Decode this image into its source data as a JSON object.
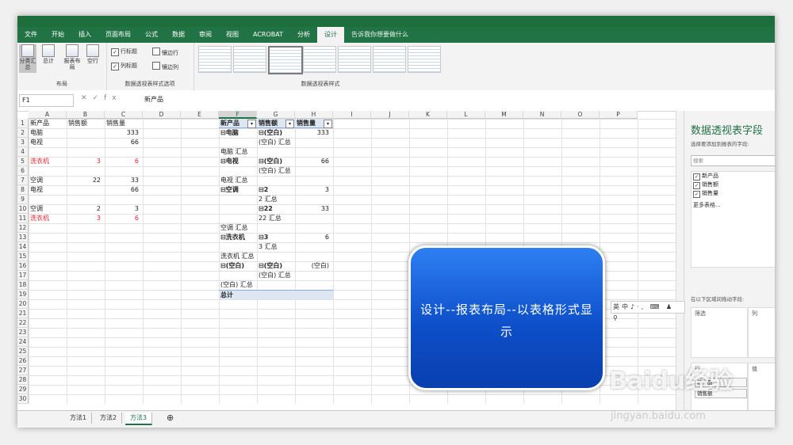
{
  "ribbon_tabs": [
    "文件",
    "开始",
    "插入",
    "页面布局",
    "公式",
    "数据",
    "审阅",
    "视图",
    "ACROBAT",
    "分析",
    "设计"
  ],
  "tell_me": "告诉我你想要做什么",
  "ribbon": {
    "layout_buttons": [
      "分类汇总",
      "总计",
      "报表布局",
      "空行"
    ],
    "group_layout": "布局",
    "options": [
      {
        "label": "行标题",
        "checked": true
      },
      {
        "label": "镶边行",
        "checked": false
      },
      {
        "label": "列标题",
        "checked": true
      },
      {
        "label": "镶边列",
        "checked": false
      }
    ],
    "group_options": "数据透视表样式选项",
    "group_styles": "数据透视表样式"
  },
  "formula": {
    "name_box": "F1",
    "fx": "fx",
    "value": "新产品"
  },
  "columns": [
    "A",
    "B",
    "C",
    "D",
    "E",
    "F",
    "G",
    "H",
    "I",
    "J",
    "K",
    "L",
    "M",
    "N",
    "O",
    "P"
  ],
  "rows": [
    "1",
    "2",
    "3",
    "4",
    "5",
    "6",
    "7",
    "8",
    "9",
    "10",
    "11",
    "12",
    "13",
    "14",
    "15",
    "16",
    "17",
    "18",
    "19",
    "20",
    "21",
    "22",
    "23",
    "24",
    "25",
    "26",
    "27",
    "28",
    "29",
    "30",
    "31"
  ],
  "table": {
    "headers": [
      "新产品",
      "销售额",
      "销售量"
    ],
    "rows": [
      {
        "a": "电脑",
        "b": "",
        "c": "333",
        "red": false
      },
      {
        "a": "电视",
        "b": "",
        "c": "66",
        "red": false
      },
      {
        "a": "",
        "b": "",
        "c": "",
        "red": false
      },
      {
        "a": "洗衣机",
        "b": "3",
        "c": "6",
        "red": true
      },
      {
        "a": "",
        "b": "",
        "c": "",
        "red": false
      },
      {
        "a": "空调",
        "b": "22",
        "c": "33",
        "red": false
      },
      {
        "a": "电视",
        "b": "",
        "c": "66",
        "red": false
      },
      {
        "a": "",
        "b": "",
        "c": "",
        "red": false
      },
      {
        "a": "空调",
        "b": "2",
        "c": "3",
        "red": false
      },
      {
        "a": "洗衣机",
        "b": "3",
        "c": "6",
        "red": true
      }
    ]
  },
  "pivot": {
    "headers": [
      "新产品",
      "销售额",
      "销售量"
    ],
    "rows": [
      {
        "f": "⊟电脑",
        "g": "⊟(空白)",
        "h": "333",
        "fb": true,
        "gb": true
      },
      {
        "f": "",
        "g": "(空白) 汇总",
        "h": "",
        "fb": false,
        "gb": false
      },
      {
        "f": "电脑 汇总",
        "g": "",
        "h": "",
        "fb": false,
        "gb": false
      },
      {
        "f": "⊟电视",
        "g": "⊟(空白)",
        "h": "66",
        "fb": true,
        "gb": true
      },
      {
        "f": "",
        "g": "(空白) 汇总",
        "h": "",
        "fb": false,
        "gb": false
      },
      {
        "f": "电视 汇总",
        "g": "",
        "h": "",
        "fb": false,
        "gb": false
      },
      {
        "f": "⊟空调",
        "g": "⊟2",
        "h": "3",
        "fb": true,
        "gb": true
      },
      {
        "f": "",
        "g": "2 汇总",
        "h": "",
        "fb": false,
        "gb": false
      },
      {
        "f": "",
        "g": "⊟22",
        "h": "33",
        "fb": false,
        "gb": true
      },
      {
        "f": "",
        "g": "22 汇总",
        "h": "",
        "fb": false,
        "gb": false
      },
      {
        "f": "空调 汇总",
        "g": "",
        "h": "",
        "fb": false,
        "gb": false
      },
      {
        "f": "⊟洗衣机",
        "g": "⊟3",
        "h": "6",
        "fb": true,
        "gb": true
      },
      {
        "f": "",
        "g": "3 汇总",
        "h": "",
        "fb": false,
        "gb": false
      },
      {
        "f": "洗衣机 汇总",
        "g": "",
        "h": "",
        "fb": false,
        "gb": false
      },
      {
        "f": "⊟(空白)",
        "g": "⊟(空白)",
        "h": "(空白)",
        "fb": true,
        "gb": true
      },
      {
        "f": "",
        "g": "(空白) 汇总",
        "h": "",
        "fb": false,
        "gb": false
      },
      {
        "f": "(空白) 汇总",
        "g": "",
        "h": "",
        "fb": false,
        "gb": false
      }
    ],
    "total": "总计"
  },
  "sheets": [
    "方法1",
    "方法2",
    "方法3"
  ],
  "field_pane": {
    "title": "数据透视表字段",
    "subtitle": "选择要添加到报表的字段:",
    "search": "搜索",
    "fields": [
      "新产品",
      "销售额",
      "销售量"
    ],
    "more": "更多表格...",
    "drag_hint": "在以下区域间拖动字段:",
    "filter": "筛选",
    "columns": "列",
    "rows": "行",
    "values": "值",
    "row_items": [
      "新产品",
      "销售额"
    ]
  },
  "callout": {
    "text": "设计--报表布局--以表格形式显示"
  },
  "minitool": "英中♪·, ⌨ ♟ ⚲",
  "watermark": "Baidu经验",
  "watermark_url": "jingyan.baidu.com",
  "colors": {
    "excel_green": "#217346",
    "callout_blue": "#0d4fc9",
    "red_text": "#e8242c"
  }
}
